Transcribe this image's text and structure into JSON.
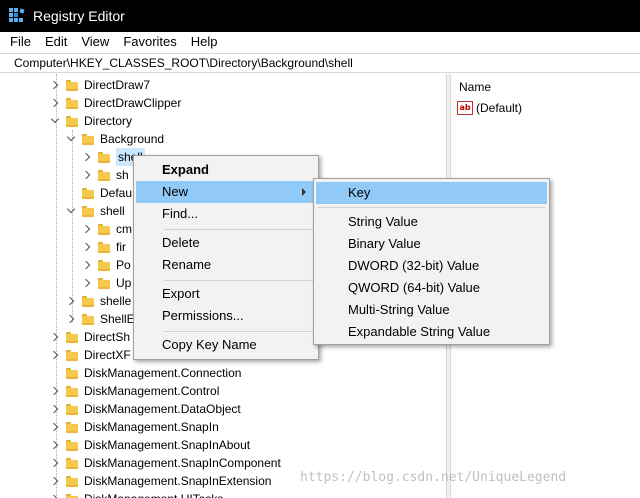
{
  "window": {
    "title": "Registry Editor"
  },
  "menu": [
    "File",
    "Edit",
    "View",
    "Favorites",
    "Help"
  ],
  "address": "Computer\\HKEY_CLASSES_ROOT\\Directory\\Background\\shell",
  "tree": [
    "DirectDraw7",
    "DirectDrawClipper",
    "Directory",
    "Background",
    "shell",
    "sh",
    "Defau",
    "shell",
    "cm",
    "fir",
    "Po",
    "Up",
    "shelle",
    "ShellE",
    "DirectSh",
    "DirectXF",
    "DiskManagement.Connection",
    "DiskManagement.Control",
    "DiskManagement.DataObject",
    "DiskManagement.SnapIn",
    "DiskManagement.SnapInAbout",
    "DiskManagement.SnapInComponent",
    "DiskManagement.SnapInExtension",
    "DiskManagement.UITasks"
  ],
  "right_pane": {
    "column_name": "Name",
    "value_icon": "ab",
    "value_name": "(Default)"
  },
  "context_menu": {
    "expand": "Expand",
    "new": "New",
    "find": "Find...",
    "delete": "Delete",
    "rename": "Rename",
    "export": "Export",
    "permissions": "Permissions...",
    "copy_key_name": "Copy Key Name"
  },
  "submenu": [
    "Key",
    "String Value",
    "Binary Value",
    "DWORD (32-bit) Value",
    "QWORD (64-bit) Value",
    "Multi-String Value",
    "Expandable String Value"
  ],
  "watermark": "https://blog.csdn.net/UniqueLegend",
  "colors": {
    "selection": "#cce8ff",
    "menu_hover": "#91c9f7",
    "folder": "#f6c94a"
  },
  "icons": {
    "app": "registry-editor-icon",
    "folder": "folder-icon",
    "string_value": "string-value-icon"
  }
}
